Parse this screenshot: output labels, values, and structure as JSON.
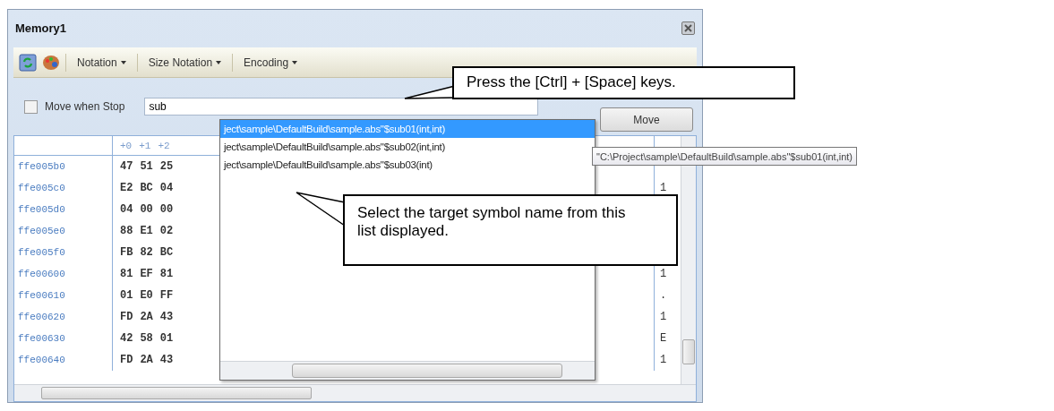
{
  "window": {
    "title": "Memory1"
  },
  "toolbar": {
    "menus": [
      "Notation",
      "Size Notation",
      "Encoding"
    ]
  },
  "address_bar": {
    "checkbox": {
      "label": "Move when Stop",
      "checked": false
    },
    "value": "sub",
    "button": "Move"
  },
  "memory": {
    "header": [
      "+0",
      "+1",
      "+2"
    ],
    "rows": [
      {
        "address": "ffe005b0",
        "bytes": [
          "47",
          "51",
          "25"
        ]
      },
      {
        "address": "ffe005c0",
        "bytes": [
          "E2",
          "BC",
          "04"
        ],
        "ascii": "1"
      },
      {
        "address": "ffe005d0",
        "bytes": [
          "04",
          "00",
          "00"
        ]
      },
      {
        "address": "ffe005e0",
        "bytes": [
          "88",
          "E1",
          "02"
        ]
      },
      {
        "address": "ffe005f0",
        "bytes": [
          "FB",
          "82",
          "BC"
        ]
      },
      {
        "address": "ffe00600",
        "bytes": [
          "81",
          "EF",
          "81"
        ],
        "ascii": "1"
      },
      {
        "address": "ffe00610",
        "bytes": [
          "01",
          "E0",
          "FF"
        ],
        "ascii": "."
      },
      {
        "address": "ffe00620",
        "bytes": [
          "FD",
          "2A",
          "43"
        ],
        "ascii": "1"
      },
      {
        "address": "ffe00630",
        "bytes": [
          "42",
          "58",
          "01"
        ],
        "ascii": "E"
      },
      {
        "address": "ffe00640",
        "bytes": [
          "FD",
          "2A",
          "43"
        ],
        "ascii": "1"
      }
    ]
  },
  "autocomplete": {
    "items": [
      {
        "text": "ject\\sample\\DefaultBuild\\sample.abs\"$sub01(int,int)",
        "selected": true
      },
      {
        "text": "ject\\sample\\DefaultBuild\\sample.abs\"$sub02(int,int)",
        "selected": false
      },
      {
        "text": "ject\\sample\\DefaultBuild\\sample.abs\"$sub03(int)",
        "selected": false
      }
    ]
  },
  "tooltip": "\"C:\\Project\\sample\\DefaultBuild\\sample.abs\"$sub01(int,int)",
  "callouts": [
    {
      "text": "Press the [Ctrl] + [Space] keys."
    },
    {
      "text": "Select the target symbol name from this list displayed."
    }
  ]
}
